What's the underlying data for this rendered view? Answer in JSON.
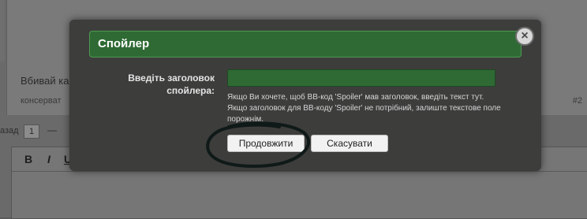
{
  "background": {
    "post_title": "Вбивай ка",
    "post_meta": "консерват",
    "post_number": "#2",
    "pager_label": "азад",
    "pager_page": "1",
    "toolbar": [
      "B",
      "I",
      "U"
    ]
  },
  "dialog": {
    "title": "Спойлер",
    "close_glyph": "×",
    "field_label": "Введіть заголовок спойлера:",
    "field_value": "",
    "field_placeholder": "",
    "hint": "Якщо Ви хочете, щоб BB-код 'Spoiler' мав заголовок, введіть текст тут. Якщо заголовок для BB-коду 'Spoiler' не потрібний, залиште текстове поле порожнім.",
    "continue_label": "Продовжити",
    "cancel_label": "Скасувати"
  },
  "colors": {
    "header_green": "#2f6a34",
    "input_green": "#2f6a34",
    "dialog_bg": "#3d3d3c",
    "scribble": "#0f1a18"
  },
  "icons": {
    "close": "close-icon"
  }
}
